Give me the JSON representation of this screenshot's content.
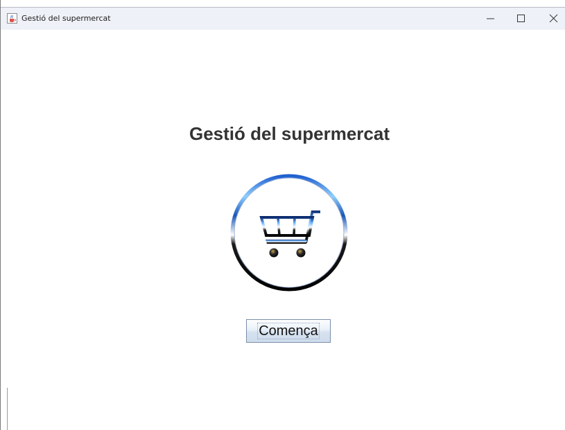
{
  "window": {
    "title": "Gestió del supermercat",
    "app_icon": "java-cup-icon",
    "controls": {
      "minimize_icon": "minimize-icon",
      "maximize_icon": "maximize-icon",
      "close_icon": "close-icon"
    }
  },
  "main": {
    "heading": "Gestió del supermercat",
    "logo_icon": "shopping-cart-icon",
    "start_button_label": "Comença"
  },
  "colors": {
    "titlebar_bg": "#eef1f7",
    "heading_text": "#333333",
    "logo_ring_top": "#3a7bd5",
    "logo_ring_bottom": "#111111"
  }
}
